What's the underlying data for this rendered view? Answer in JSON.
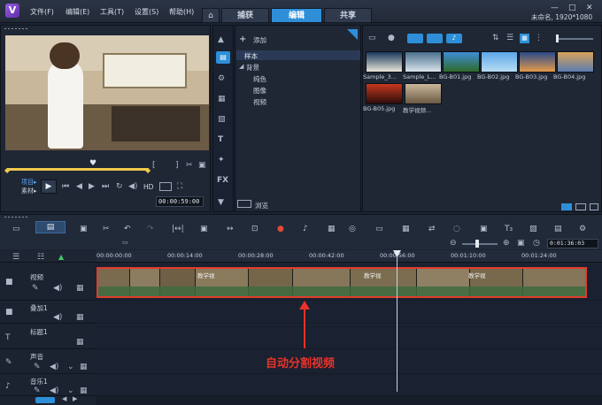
{
  "menu": [
    "文件(F)",
    "编辑(E)",
    "工具(T)",
    "设置(S)",
    "帮助(H)"
  ],
  "tabs": [
    "捕获",
    "编辑",
    "共享"
  ],
  "project_info": "未命名, 1920*1080",
  "player": {
    "mode_project": "项目▸",
    "mode_clip": "素材▸",
    "timecode": "00:00:59:00",
    "hd": "HD"
  },
  "library": {
    "add_label": "添加",
    "tree": [
      "样本",
      "背景",
      "纯色",
      "图像",
      "视频"
    ],
    "browse_label": "浏览"
  },
  "media": [
    {
      "name": "Sample_3...",
      "c1": "#1b3a5c",
      "c2": "#e8e4d8"
    },
    {
      "name": "Sample_L...",
      "c1": "#4a6f8c",
      "c2": "#d9e4ec"
    },
    {
      "name": "BG-B01.jpg",
      "c1": "#3f8dd6",
      "c2": "#2e6b2a"
    },
    {
      "name": "BG-B02.jpg",
      "c1": "#5aa8e8",
      "c2": "#b8dcf2"
    },
    {
      "name": "BG-B03.jpg",
      "c1": "#2a4a8a",
      "c2": "#e49a4a"
    },
    {
      "name": "BG-B04.jpg",
      "c1": "#d8a25a",
      "c2": "#5c7db0"
    },
    {
      "name": "BG-B05.jpg",
      "c1": "#c7381f",
      "c2": "#2a0d0a"
    },
    {
      "name": "教学视频...",
      "c1": "#c9b79a",
      "c2": "#6b5a44"
    }
  ],
  "timeline": {
    "ruler": [
      "00:00:00:00",
      "00:00:14:00",
      "00:00:28:00",
      "00:00:42:00",
      "00:00:56:00",
      "00:01:10:00",
      "00:01:24:00"
    ],
    "zoom_time": "0:01:36:03",
    "clip_label": "教学视",
    "tracks": [
      "视频",
      "叠加1",
      "标题1",
      "声音",
      "音乐1"
    ]
  },
  "annotation": "自动分割视频"
}
